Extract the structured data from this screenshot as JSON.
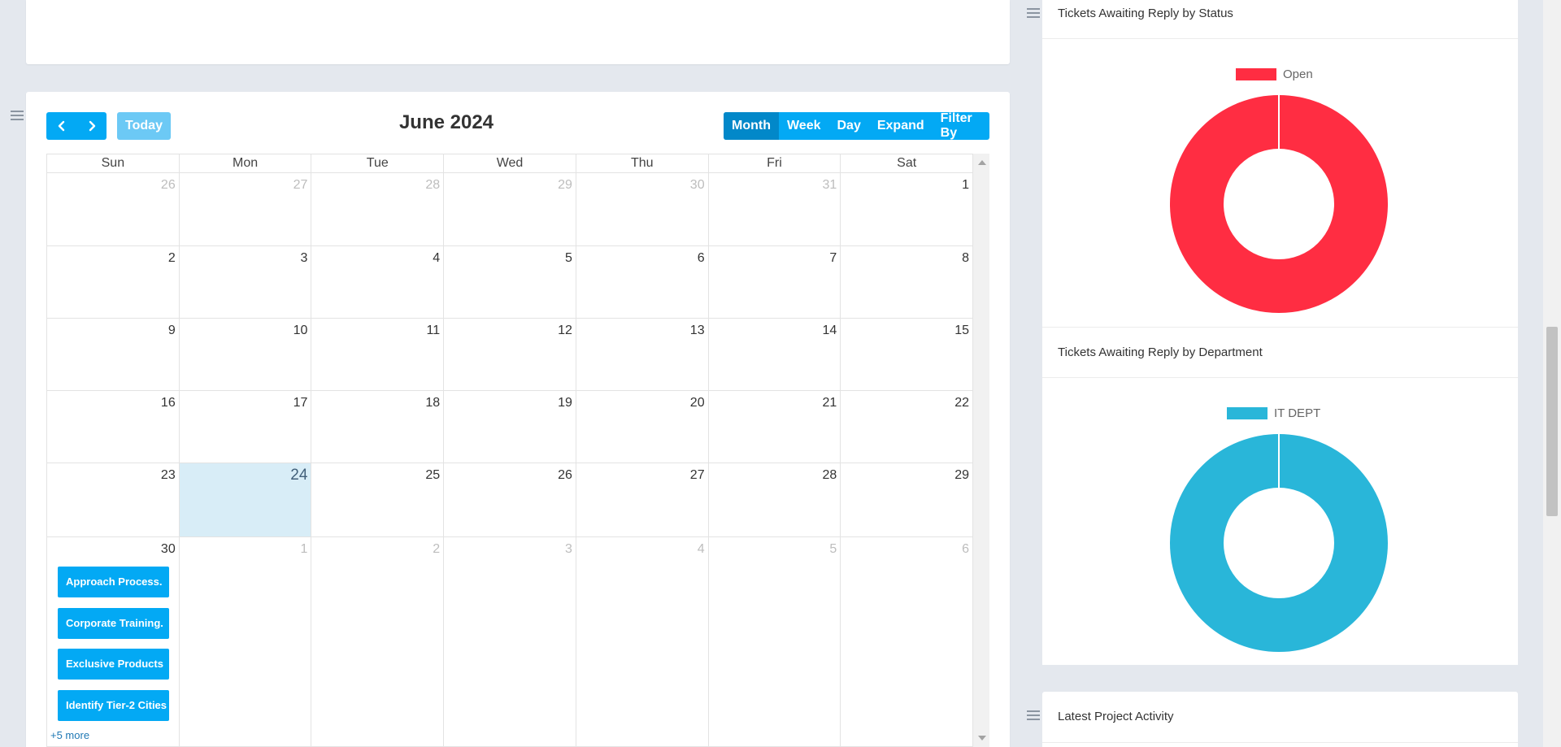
{
  "calendar": {
    "title": "June 2024",
    "today_label": "Today",
    "views": [
      "Month",
      "Week",
      "Day",
      "Expand",
      "Filter By"
    ],
    "active_view": "Month",
    "days_of_week": [
      "Sun",
      "Mon",
      "Tue",
      "Wed",
      "Thu",
      "Fri",
      "Sat"
    ],
    "weeks": [
      [
        {
          "n": "26",
          "o": true
        },
        {
          "n": "27",
          "o": true
        },
        {
          "n": "28",
          "o": true
        },
        {
          "n": "29",
          "o": true
        },
        {
          "n": "30",
          "o": true
        },
        {
          "n": "31",
          "o": true
        },
        {
          "n": "1"
        }
      ],
      [
        {
          "n": "2"
        },
        {
          "n": "3"
        },
        {
          "n": "4"
        },
        {
          "n": "5"
        },
        {
          "n": "6"
        },
        {
          "n": "7"
        },
        {
          "n": "8"
        }
      ],
      [
        {
          "n": "9"
        },
        {
          "n": "10"
        },
        {
          "n": "11"
        },
        {
          "n": "12"
        },
        {
          "n": "13"
        },
        {
          "n": "14"
        },
        {
          "n": "15"
        }
      ],
      [
        {
          "n": "16"
        },
        {
          "n": "17"
        },
        {
          "n": "18"
        },
        {
          "n": "19"
        },
        {
          "n": "20"
        },
        {
          "n": "21"
        },
        {
          "n": "22"
        }
      ],
      [
        {
          "n": "23"
        },
        {
          "n": "24",
          "today": true
        },
        {
          "n": "25"
        },
        {
          "n": "26"
        },
        {
          "n": "27"
        },
        {
          "n": "28"
        },
        {
          "n": "29"
        }
      ],
      [
        {
          "n": "30"
        },
        {
          "n": "1",
          "o": true
        },
        {
          "n": "2",
          "o": true
        },
        {
          "n": "3",
          "o": true
        },
        {
          "n": "4",
          "o": true
        },
        {
          "n": "5",
          "o": true
        },
        {
          "n": "6",
          "o": true
        }
      ]
    ],
    "events": [
      "Approach Process.",
      "Corporate Training.",
      "Exclusive Products",
      "Identify Tier-2 Cities"
    ],
    "more_link": "+5 more"
  },
  "widgets": {
    "status": {
      "title": "Tickets Awaiting Reply by Status",
      "legend": "Open",
      "color": "#ff2d42"
    },
    "department": {
      "title": "Tickets Awaiting Reply by Department",
      "legend": "IT DEPT",
      "color": "#29b6d9"
    },
    "activity": {
      "title": "Latest Project Activity"
    }
  },
  "colors": {
    "primary": "#03a9f4",
    "today_bg": "#d8edf7"
  }
}
